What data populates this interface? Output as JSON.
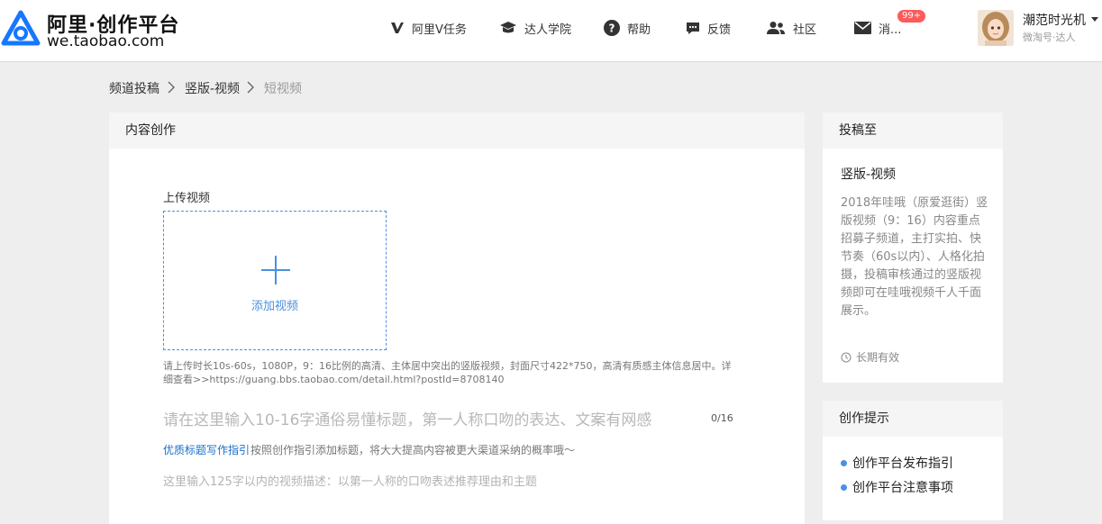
{
  "header": {
    "logo_title": "阿里·创作平台",
    "logo_sub": "we.taobao.com",
    "nav": [
      {
        "label": "阿里V任务",
        "icon": "v-task-icon"
      },
      {
        "label": "达人学院",
        "icon": "graduation-cap-icon"
      },
      {
        "label": "帮助",
        "icon": "question-icon"
      },
      {
        "label": "反馈",
        "icon": "feedback-icon"
      },
      {
        "label": "社区",
        "icon": "community-icon"
      },
      {
        "label": "消...",
        "icon": "mail-icon"
      }
    ],
    "message_badge": "99+",
    "user": {
      "name": "潮范时光机",
      "sub": "微淘号·达人"
    }
  },
  "breadcrumb": [
    "频道投稿",
    "竖版-视频",
    "短视频"
  ],
  "main": {
    "section_title": "内容创作",
    "upload_label": "上传视频",
    "upload_button": "添加视频",
    "upload_hint": "请上传时长10s-60s，1080P，9：16比例的高清、主体居中突出的竖版视频，封面尺寸422*750，高清有质感主体信息居中。详细查看>>https://guang.bbs.taobao.com/detail.html?postId=8708140",
    "title_placeholder": "请在这里输入10-16字通俗易懂标题，第一人称口吻的表达、文案有网感",
    "title_counter": "0/16",
    "guide_link": "优质标题写作指引",
    "guide_text": "按照创作指引添加标题，将大大提高内容被更大渠道采纳的概率哦～",
    "desc_placeholder": "这里输入125字以内的视频描述：以第一人称的口吻表述推荐理由和主题"
  },
  "submit_to": {
    "section_title": "投稿至",
    "channel": "竖版-视频",
    "description": "2018年哇哦（原爱逛街）竖版视频（9：16）内容重点招募子频道，主打实拍、快节奏（60s以内）、人格化拍摄，投稿审核通过的竖版视频即可在哇哦视频千人千面展示。",
    "validity": "长期有效"
  },
  "tips": {
    "section_title": "创作提示",
    "items": [
      "创作平台发布指引",
      "创作平台注意事项"
    ]
  },
  "colors": {
    "accent": "#4a90e2",
    "link": "#1a6fc9",
    "badge": "#ff5a5a"
  }
}
